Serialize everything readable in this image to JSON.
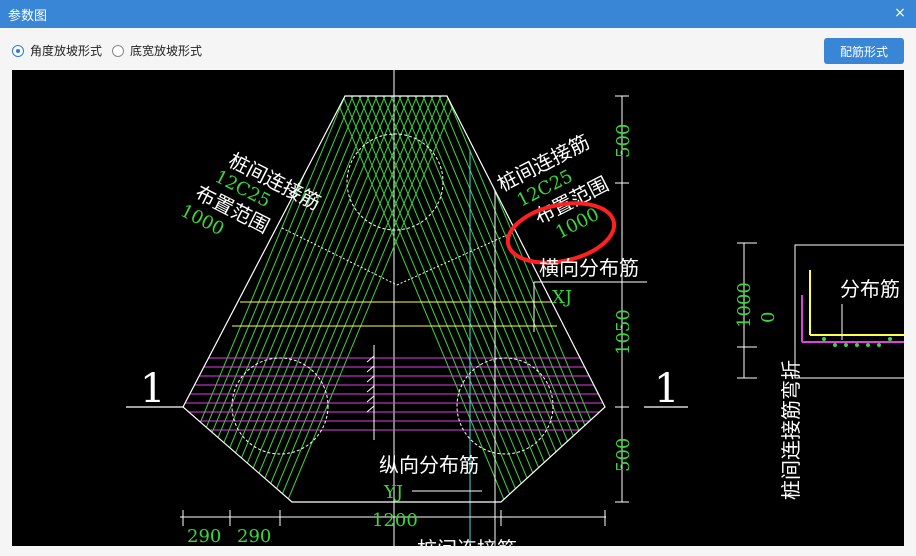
{
  "window": {
    "title": "参数图",
    "close_icon": "×"
  },
  "toolbar": {
    "options": [
      {
        "label": "角度放坡形式",
        "checked": true
      },
      {
        "label": "底宽放坡形式",
        "checked": false
      }
    ],
    "config_button": "配筋形式"
  },
  "drawing": {
    "section_mark": "1",
    "labels": {
      "pile_connect": "桩间连接筋",
      "spec": "12C25",
      "range": "布置范围",
      "range_value": "1000",
      "cross_dist": "横向分布筋",
      "cross_code": "XJ",
      "long_dist": "纵向分布筋",
      "long_code": "YJ",
      "side_label": "分布筋",
      "vertical_label": "桩间连接筋弯折",
      "bottom_label": "桩间连接筋"
    },
    "dims": {
      "d500": "500",
      "d1050": "1050",
      "d1200": "1200",
      "d290": "290",
      "d1000": "1000",
      "d0": "0"
    }
  },
  "colors": {
    "titlebar": "#3a86d6",
    "canvas": "#000000",
    "rebar": "#39d839",
    "outline": "#ffffff",
    "magenta": "#e040e0",
    "yellow": "#ffff44",
    "annotation": "#ff2020",
    "cyan": "#40e0e0"
  }
}
